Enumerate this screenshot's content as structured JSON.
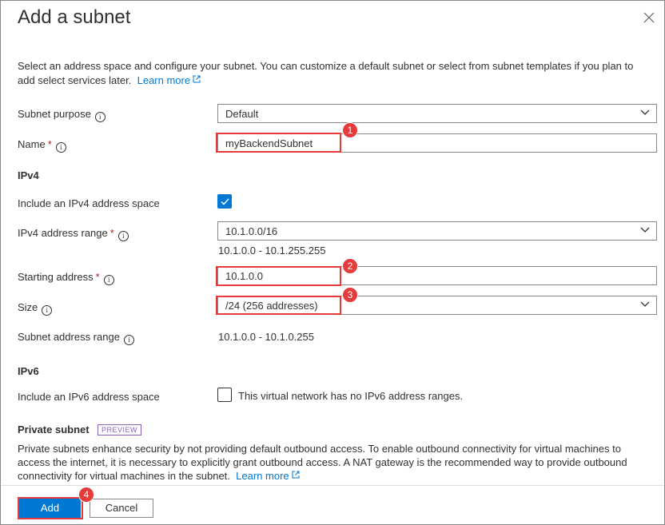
{
  "dialog": {
    "title": "Add a subnet",
    "intro_text": "Select an address space and configure your subnet. You can customize a default subnet or select from subnet templates if you plan to add select services later.",
    "learn_more": "Learn more"
  },
  "fields": {
    "subnet_purpose": {
      "label": "Subnet purpose",
      "value": "Default"
    },
    "name": {
      "label": "Name",
      "required_mark": "*",
      "value": "myBackendSubnet"
    },
    "ipv4_section": "IPv4",
    "include_ipv4": {
      "label": "Include an IPv4 address space",
      "checked": true
    },
    "ipv4_range": {
      "label": "IPv4 address range",
      "required_mark": "*",
      "value": "10.1.0.0/16",
      "range_text": "10.1.0.0 - 10.1.255.255"
    },
    "starting_address": {
      "label": "Starting address",
      "required_mark": "*",
      "value": "10.1.0.0"
    },
    "size": {
      "label": "Size",
      "value": "/24 (256 addresses)"
    },
    "subnet_range": {
      "label": "Subnet address range",
      "value": "10.1.0.0 - 10.1.0.255"
    },
    "ipv6_section": "IPv6",
    "include_ipv6": {
      "label": "Include an IPv6 address space",
      "checked": false,
      "note": "This virtual network has no IPv6 address ranges."
    }
  },
  "private_subnet": {
    "title": "Private subnet",
    "badge": "PREVIEW",
    "text": "Private subnets enhance security by not providing default outbound access. To enable outbound connectivity for virtual machines to access the internet, it is necessary to explicitly grant outbound access. A NAT gateway is the recommended way to provide outbound connectivity for virtual machines in the subnet.",
    "learn_more": "Learn more"
  },
  "footer": {
    "add_label": "Add",
    "cancel_label": "Cancel"
  },
  "annotations": {
    "m1": "1",
    "m2": "2",
    "m3": "3",
    "m4": "4"
  },
  "icons": {
    "close": "close-icon",
    "info": "info-icon",
    "chevron": "chevron-down-icon",
    "external": "external-link-icon",
    "check": "checkmark-icon"
  },
  "colors": {
    "accent": "#0078d4",
    "highlight": "#e63b3b",
    "required": "#a4262c",
    "preview": "#8764b8"
  }
}
